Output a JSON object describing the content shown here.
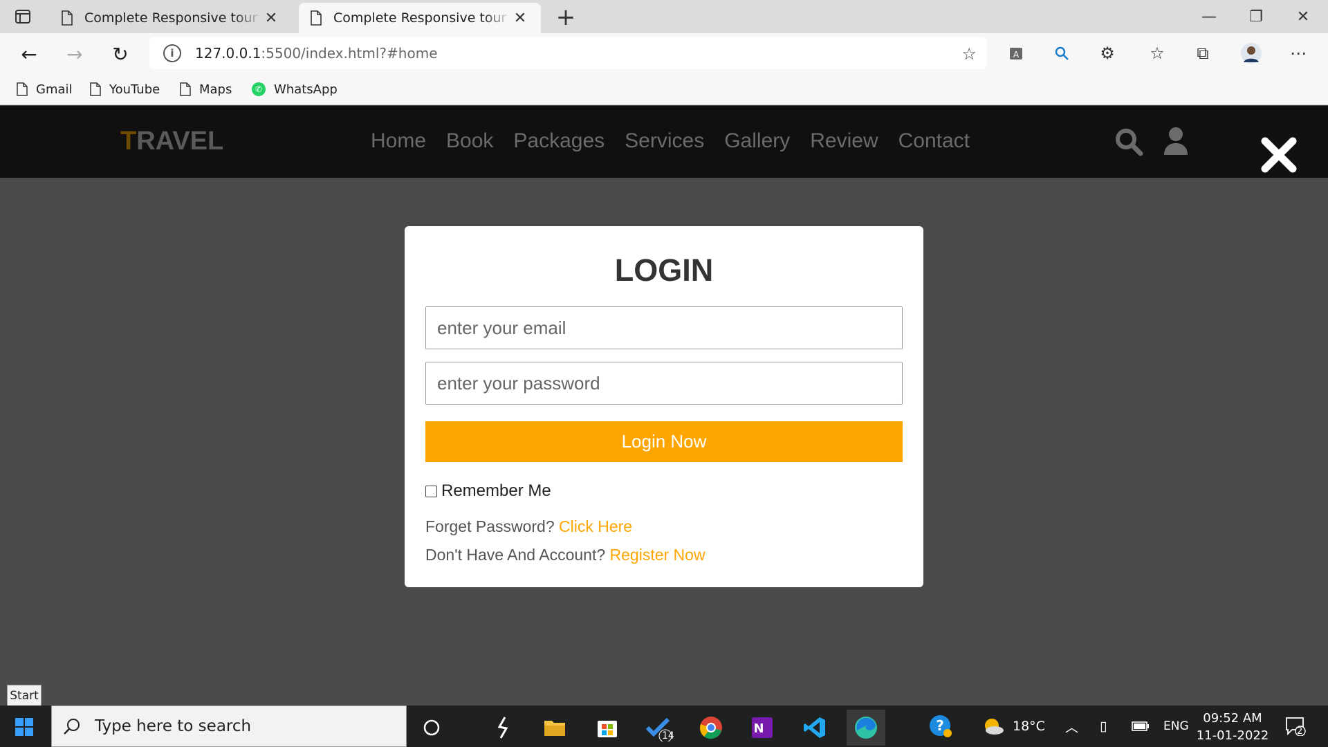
{
  "browser": {
    "tabs": [
      {
        "title": "Complete Responsive tour and travel"
      },
      {
        "title": "Complete Responsive tour and travel"
      }
    ],
    "url_host": "127.0.0.1",
    "url_rest": ":5500/index.html?#home",
    "bookmarks": [
      "Gmail",
      "YouTube",
      "Maps",
      "WhatsApp"
    ]
  },
  "site": {
    "logo_first": "T",
    "logo_rest": "RAVEL",
    "nav": [
      "Home",
      "Book",
      "Packages",
      "Services",
      "Gallery",
      "Review",
      "Contact"
    ]
  },
  "login": {
    "heading": "LOGIN",
    "email_placeholder": "enter your email",
    "password_placeholder": "enter your password",
    "submit_label": "Login Now",
    "remember_label": "Remember Me",
    "forgot_text": "Forget Password?",
    "forgot_link": "Click Here",
    "register_text": "Don't Have And Account?",
    "register_link": "Register Now"
  },
  "tooltip": "Start",
  "taskbar": {
    "search_placeholder": "Type here to search",
    "badge_count": "14",
    "temperature": "18°C",
    "language": "ENG",
    "time": "09:52 AM",
    "date": "11-01-2022",
    "notification_count": "2"
  }
}
